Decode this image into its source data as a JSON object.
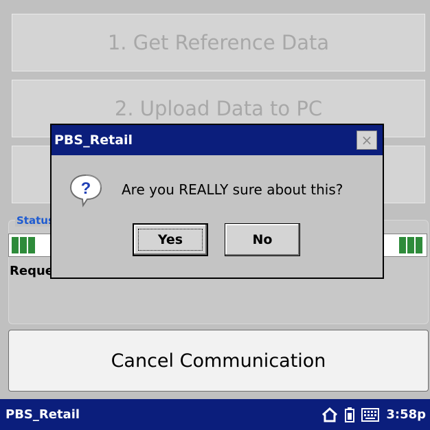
{
  "background_buttons": [
    {
      "label": "1. Get Reference Data"
    },
    {
      "label": "2. Upload Data to PC"
    },
    {
      "label": ""
    }
  ],
  "status": {
    "label": "Status",
    "message": "Requesting...",
    "progress_segments": 6,
    "segment_color": "#2e8b3a"
  },
  "cancel_button": {
    "label": "Cancel Communication"
  },
  "taskbar": {
    "app_name": "PBS_Retail",
    "time": "3:58p",
    "icons": [
      "home-icon",
      "battery-icon",
      "keyboard-icon"
    ]
  },
  "dialog": {
    "title": "PBS_Retail",
    "message": "Are you REALLY sure about this?",
    "icon": "question-icon",
    "yes_label": "Yes",
    "no_label": "No",
    "close_glyph": "×"
  },
  "colors": {
    "title_bar": "#0b1e7c",
    "status_label": "#1e5bd1",
    "disabled_text": "#a8a8a8"
  }
}
